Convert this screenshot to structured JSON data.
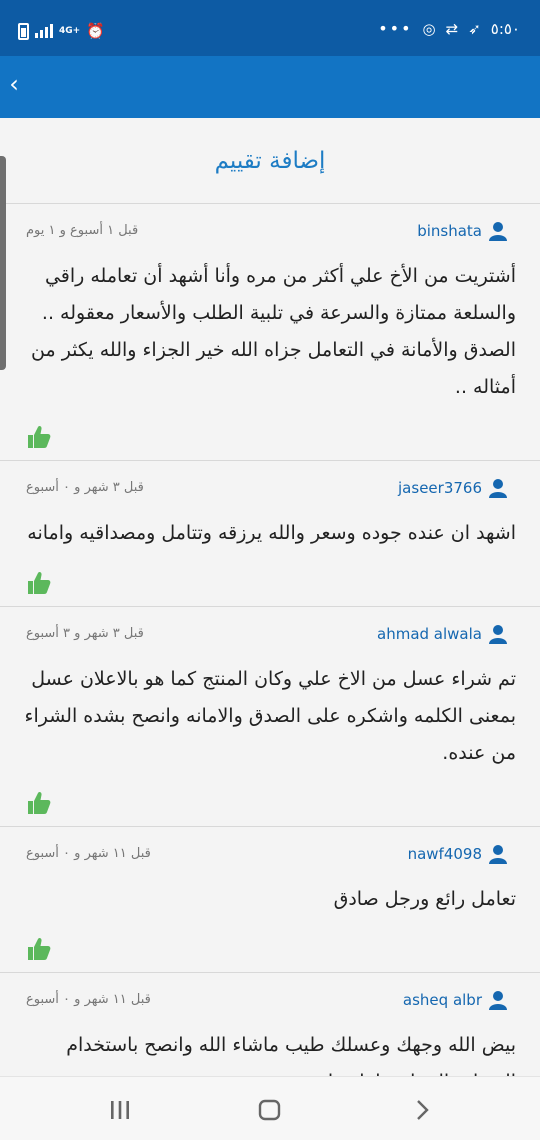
{
  "status_bar": {
    "time": "٥:٥٠",
    "network": "4G+",
    "dots": "•••",
    "icons": [
      "battery-icon",
      "signal-icon",
      "alarm-icon",
      "messenger-icon",
      "transfer-icon",
      "shoe-icon"
    ]
  },
  "page": {
    "back_icon": "chevron-left-icon",
    "add_review_label": "إضافة تقييم"
  },
  "reviews": [
    {
      "user": "binshata",
      "date": "قبل ١ أسبوع و ١ يوم",
      "text": "أشتريت من الأخ علي أكثر من مره وأنا أشهد أن تعامله راقي والسلعة ممتازة والسرعة في تلبية الطلب والأسعار معقوله .. الصدق والأمانة في التعامل جزاه الله خير الجزاء والله يكثر من أمثاله .."
    },
    {
      "user": "jaseer3766",
      "date": "قبل ٣ شهر و ٠ أسبوع",
      "text": "اشهد ان عنده جوده وسعر والله يرزقه وتتامل ومصداقيه وامانه"
    },
    {
      "user": "ahmad alwala",
      "date": "قبل ٣ شهر و ٣ أسبوع",
      "text": "تم شراء عسل من الاخ علي وكان المنتج كما هو بالاعلان عسل بمعنى الكلمه واشكره على الصدق والامانه وانصح بشده الشراء من عنده."
    },
    {
      "user": "nawf4098",
      "date": "قبل ١١ شهر و ٠ أسبوع",
      "text": "تعامل رائع ورجل صادق"
    },
    {
      "user": "asheq albr",
      "date": "قبل ١١ شهر و ٠ أسبوع",
      "text": "بيض الله وجهك وعسلك طيب ماشاء الله وانصح باستخدام العسل والرجل تعامله طيب"
    }
  ],
  "nav": {
    "icons": [
      "recent-apps-icon",
      "home-icon",
      "back-icon"
    ]
  },
  "colors": {
    "status_bar": "#0d5ba4",
    "app_bar": "#1274c4",
    "link": "#1567b0",
    "like": "#5cb85c"
  }
}
